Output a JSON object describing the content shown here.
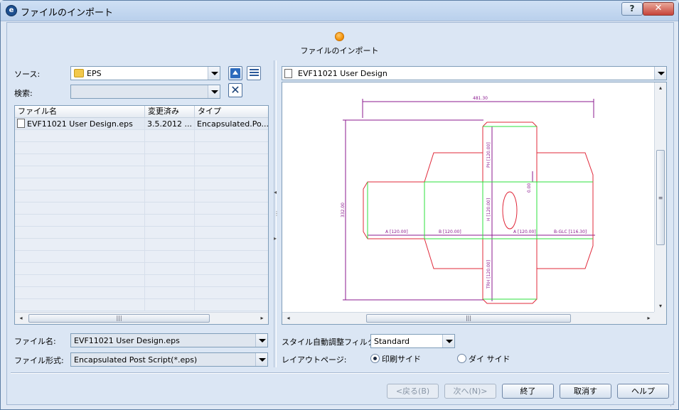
{
  "window": {
    "title": "ファイルのインポート",
    "help_label": "?",
    "close_label": "✕"
  },
  "step": {
    "label": "ファイルのインポート"
  },
  "source": {
    "label": "ソース:",
    "value": "EPS"
  },
  "search": {
    "label": "検索:",
    "value": ""
  },
  "file_list": {
    "columns": [
      "ファイル名",
      "変更済み",
      "タイプ"
    ],
    "rows": [
      {
        "name": "EVF11021 User Design.eps",
        "modified": "3.5.2012 ...",
        "type": "Encapsulated.Po..."
      }
    ]
  },
  "filename": {
    "label": "ファイル名:",
    "value": "EVF11021 User Design.eps"
  },
  "filetype": {
    "label": "ファイル形式:",
    "value": "Encapsulated Post Script(*.eps)"
  },
  "preview": {
    "title": "EVF11021 User Design",
    "dims": {
      "top": "481.30",
      "left": "332.00",
      "d1": "PH [120.00]",
      "d2": "H [120.00]",
      "d3": "TRH [120.00]",
      "d4": "0.00",
      "b1": "A [120.00]",
      "b2": "B [120.00]",
      "b3": "A [120.00]",
      "b4": "B-GLC [116.30]"
    }
  },
  "style_filter": {
    "label": "スタイル自動調整フィルタ",
    "value": "Standard"
  },
  "layout_page": {
    "label": "レイアウトページ:",
    "options": [
      "印刷サイド",
      "ダイ サイド"
    ],
    "selected": "印刷サイド"
  },
  "buttons": {
    "back": "<戻る(B)",
    "next": "次へ(N)>",
    "finish": "終了",
    "cancel": "取消す",
    "help": "ヘルプ"
  },
  "colors": {
    "cut": "#e0283a",
    "crease": "#2ee03c",
    "dimension": "#8b1a8f"
  }
}
